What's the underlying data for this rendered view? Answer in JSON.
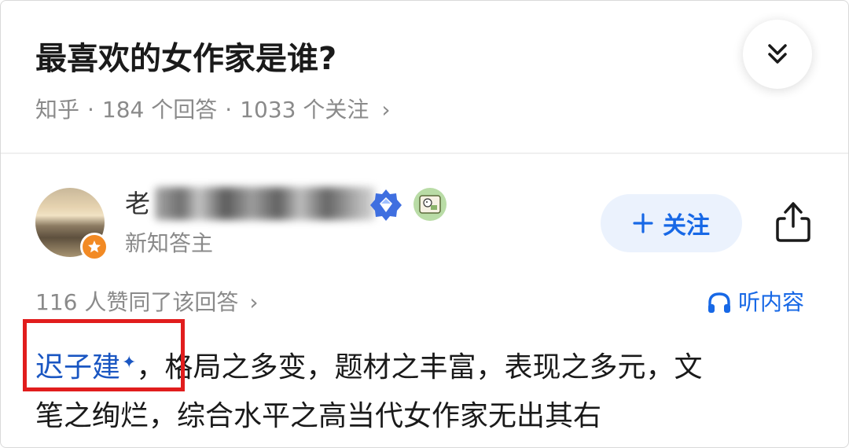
{
  "question": {
    "title": "最喜欢的女作家是谁?",
    "meta": {
      "source": "知乎",
      "separator": "·",
      "answers": "184 个回答",
      "followers": "1033 个关注",
      "chevron": "›"
    },
    "collapse_icon": "double-chevron-down-icon"
  },
  "answer": {
    "author": {
      "name_visible_prefix": "老",
      "title": "新知答主",
      "avatar_badge_icon": "orange-star-badge-icon",
      "verify_icon": "blue-diamond-verified-icon",
      "flair_icon": "cartoon-flair-icon"
    },
    "follow_label": "关注",
    "share_icon": "share-icon",
    "likes_text": "116 人赞同了该回答",
    "likes_chevron": "›",
    "listen_label": "听内容",
    "listen_icon": "headphones-icon",
    "content": {
      "link_text": "迟子建",
      "link_mark": "✦",
      "line1_rest": "，格局之多变，题材之丰富，表现之多元，文",
      "line2": "笔之绚烂，综合水平之高当代女作家无出其右"
    }
  },
  "colors": {
    "accent": "#1768e6",
    "link": "#1a56c2",
    "highlight_box": "#e11d1d",
    "meta_gray": "#8a8a8a",
    "follow_bg": "#ebf2fd"
  }
}
